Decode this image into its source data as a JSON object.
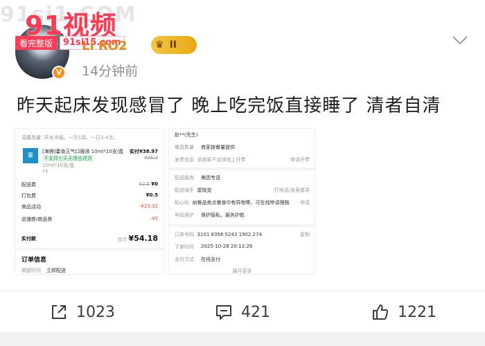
{
  "watermark": {
    "brand": "91视频",
    "ghost": "91si1.COM",
    "tag": "看完整版",
    "url": "91si15.com"
  },
  "user": {
    "name": "Li RO2",
    "vip_label": "II",
    "time": "14分钟前"
  },
  "post": {
    "text": "昨天起床发现感冒了 晚上吃完饭直接睡了 清者自清"
  },
  "screenshot_left": {
    "usage": "温馨用量: 开水冲服。一次1袋，一日3-4次。",
    "product_name": "[海狮]藿香正气口服液 10ml*10支/盒",
    "product_price": "实付¥38.97",
    "product_orig": "¥46.2",
    "product_tag": "不支持七天无理由退货",
    "product_spec": "10ml*10支/盒",
    "product_qty": "x1",
    "delivery_fee_label": "配送费",
    "delivery_fee_old": "¥2.5",
    "delivery_fee": "¥0",
    "packing_label": "打包费",
    "packing_fee": "¥0.5",
    "discount_label": "商品活动",
    "discount": "-¥23.32",
    "coupon_label": "店铺券/商品券",
    "coupon": "-¥5",
    "paid_label": "实付款",
    "paid_prefix": "合计",
    "paid": "¥54.18",
    "order_section": "订单信息",
    "order_time_label": "期望时间",
    "order_time": "立即配送"
  },
  "screenshot_right": {
    "addr": "赵**(先生)",
    "dining_label": "餐具数量",
    "dining": "商家按餐量提供",
    "invoice_label": "发票信息",
    "invoice": "该商家不支持线上开票",
    "invoice_action": "申请开票",
    "delivery_service_label": "配送服务",
    "delivery_service": "美团专送",
    "rider_label": "配送骑手",
    "rider": "雷晓克",
    "rider_action": "打电话/发表督导",
    "care_label": "贴心吃",
    "care": "如餐品卖点餐食中有异物等，可在线申请理赔",
    "care_action": "申请",
    "privacy_label": "号码保护",
    "privacy": "保护隐私，服务护航",
    "order_no_label": "订单号码",
    "order_no": "3101 8356 5243 1902 274",
    "copy": "复制",
    "order_time_label": "下单时间",
    "order_time": "2025-10-28 20:13:26",
    "pay_label": "支付方式",
    "pay": "在线支付",
    "more": "展开更多"
  },
  "actions": {
    "share_count": "1023",
    "comment_count": "421",
    "like_count": "1221"
  },
  "icons": [
    "share-icon",
    "comment-icon",
    "like-icon",
    "chevron-down-icon",
    "crown-icon",
    "search-icon"
  ]
}
